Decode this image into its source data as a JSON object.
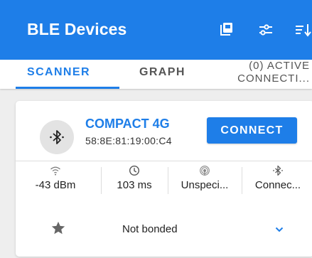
{
  "app_bar": {
    "title": "BLE Devices",
    "background": "#1e7ee8",
    "actions": [
      "stack-icon",
      "filter-sliders-icon",
      "sort-icon"
    ]
  },
  "tabs": [
    {
      "label": "SCANNER",
      "active": true
    },
    {
      "label": "GRAPH",
      "active": false
    },
    {
      "label_line1": "(0) ACTIVE",
      "label_line2": "CONNECTI...",
      "active": false
    }
  ],
  "device": {
    "name": "COMPACT 4G",
    "address": "58:8E:81:19:00:C4",
    "connect_label": "CONNECT",
    "stats": [
      {
        "icon": "wifi-signal-icon",
        "value": "-43 dBm"
      },
      {
        "icon": "clock-icon",
        "value": "103 ms"
      },
      {
        "icon": "broadcast-icon",
        "value": "Unspeci..."
      },
      {
        "icon": "bluetooth-icon",
        "value": "Connec..."
      }
    ],
    "bond_status": "Not bonded"
  },
  "colors": {
    "accent": "#1e7ee8",
    "text": "#222222",
    "background": "#eeeeee"
  }
}
